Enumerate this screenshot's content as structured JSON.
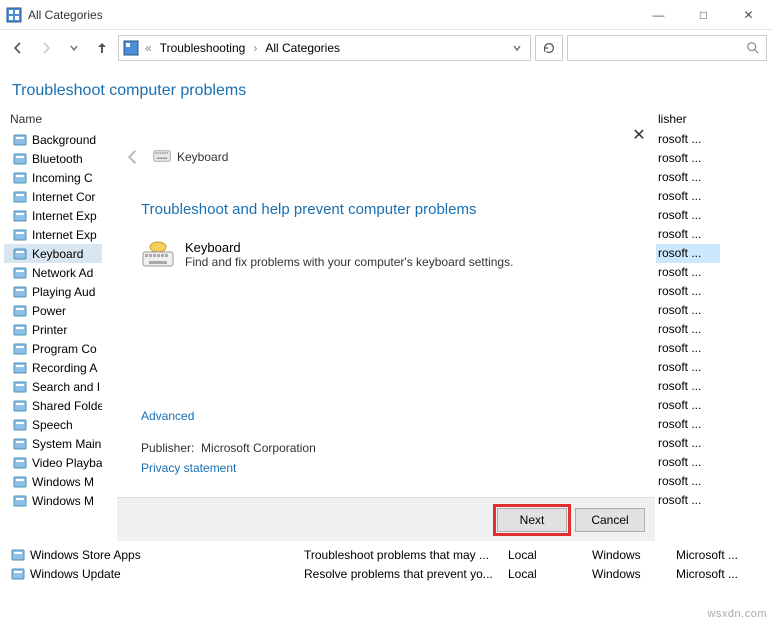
{
  "window": {
    "title": "All Categories",
    "min": "—",
    "max": "□",
    "close": "✕"
  },
  "breadcrumb": {
    "seg1": "Troubleshooting",
    "seg2": "All Categories"
  },
  "header": {
    "title": "Troubleshoot computer problems"
  },
  "columns": {
    "name": "Name",
    "publisher": "lisher"
  },
  "list": {
    "items": [
      {
        "label": "Background"
      },
      {
        "label": "Bluetooth"
      },
      {
        "label": "Incoming C"
      },
      {
        "label": "Internet Cor"
      },
      {
        "label": "Internet Exp"
      },
      {
        "label": "Internet Exp"
      },
      {
        "label": "Keyboard",
        "selected": true
      },
      {
        "label": "Network Ad"
      },
      {
        "label": "Playing Aud"
      },
      {
        "label": "Power"
      },
      {
        "label": "Printer"
      },
      {
        "label": "Program Co"
      },
      {
        "label": "Recording A"
      },
      {
        "label": "Search and I"
      },
      {
        "label": "Shared Folde"
      },
      {
        "label": "Speech"
      },
      {
        "label": "System Main"
      },
      {
        "label": "Video Playba"
      },
      {
        "label": "Windows M"
      },
      {
        "label": "Windows M"
      }
    ],
    "pub_value": "rosoft ..."
  },
  "wizard": {
    "title": "Keyboard",
    "heading": "Troubleshoot and help prevent computer problems",
    "item_name": "Keyboard",
    "item_desc": "Find and fix problems with your computer's keyboard settings.",
    "advanced": "Advanced",
    "publisher_label": "Publisher:",
    "publisher_value": "Microsoft Corporation",
    "privacy": "Privacy statement",
    "next": "Next",
    "cancel": "Cancel"
  },
  "bottom_rows": [
    {
      "name": "Windows Store Apps",
      "desc": "Troubleshoot problems that may ...",
      "loc": "Local",
      "cat": "Windows",
      "pub": "Microsoft ..."
    },
    {
      "name": "Windows Update",
      "desc": "Resolve problems that prevent yo...",
      "loc": "Local",
      "cat": "Windows",
      "pub": "Microsoft ..."
    }
  ],
  "watermark": "wsxdn.com"
}
